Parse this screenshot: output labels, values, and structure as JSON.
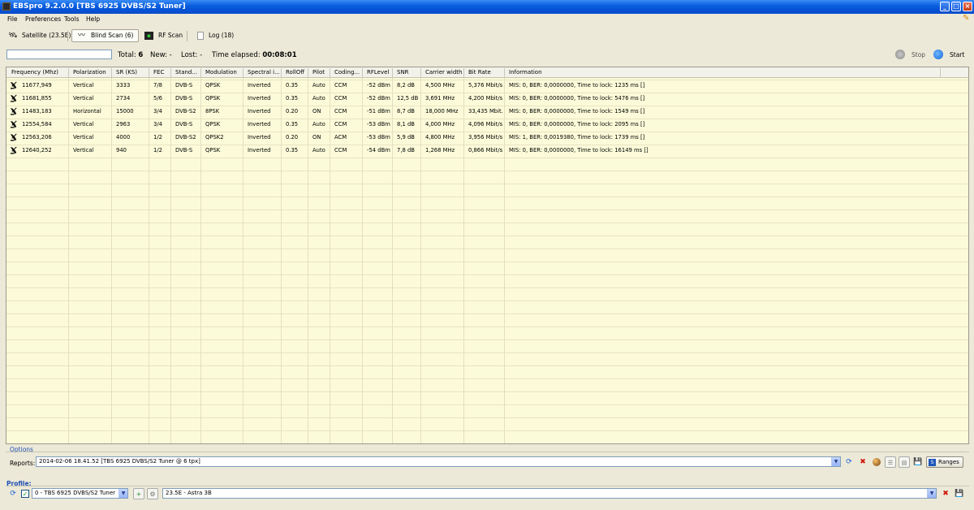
{
  "window": {
    "title": "EBSpro 9.2.0.0 [TBS 6925 DVBS/S2 Tuner]"
  },
  "menu": [
    "File",
    "Preferences",
    "Tools",
    "Help"
  ],
  "tabs": [
    {
      "label": "Satellite (23.5E)",
      "icon": "satellite-icon",
      "active": false
    },
    {
      "label": "Blind Scan (6)",
      "icon": "blind-scan-icon",
      "active": true
    },
    {
      "label": "RF Scan",
      "icon": "rf-scan-icon",
      "active": false
    },
    {
      "label": "Log (18)",
      "icon": "log-icon",
      "active": false
    }
  ],
  "status": {
    "total_label": "Total:",
    "total_value": "6",
    "new_label": "New:",
    "new_value": "-",
    "lost_label": "Lost:",
    "lost_value": "-",
    "elapsed_label": "Time elapsed:",
    "elapsed_value": "00:08:01"
  },
  "controls": {
    "stop_label": "Stop",
    "start_label": "Start"
  },
  "table": {
    "columns": [
      "Frequency (Mhz)",
      "Polarization",
      "SR (KS)",
      "FEC",
      "Stand...",
      "Modulation",
      "Spectral i...",
      "RollOff",
      "Pilot",
      "Coding...",
      "RFLevel",
      "SNR",
      "Carrier width",
      "Bit Rate",
      "Information"
    ],
    "rows": [
      [
        "11677,949",
        "Vertical",
        "3333",
        "7/8",
        "DVB-S",
        "QPSK",
        "Inverted",
        "0.35",
        "Auto",
        "CCM",
        "-52 dBm",
        "8,2 dB",
        "4,500 MHz",
        "5,376 Mbit/s",
        "MIS: 0, BER: 0,0000000, Time to lock: 1235 ms []"
      ],
      [
        "11681,855",
        "Vertical",
        "2734",
        "5/6",
        "DVB-S",
        "QPSK",
        "Inverted",
        "0.35",
        "Auto",
        "CCM",
        "-52 dBm",
        "12,5 dB",
        "3,691 MHz",
        "4,200 Mbit/s",
        "MIS: 0, BER: 0,0000000, Time to lock: 5476 ms []"
      ],
      [
        "11483,183",
        "Horizontal",
        "15000",
        "3/4",
        "DVB-S2",
        "8PSK",
        "Inverted",
        "0.20",
        "ON",
        "CCM",
        "-51 dBm",
        "8,7 dB",
        "18,000 MHz",
        "33,435 Mbit...",
        "MIS: 0, BER: 0,0000000, Time to lock: 1549 ms []"
      ],
      [
        "12554,584",
        "Vertical",
        "2963",
        "3/4",
        "DVB-S",
        "QPSK",
        "Inverted",
        "0.35",
        "Auto",
        "CCM",
        "-53 dBm",
        "8,1 dB",
        "4,000 MHz",
        "4,096 Mbit/s",
        "MIS: 0, BER: 0,0000000, Time to lock: 2095 ms []"
      ],
      [
        "12563,206",
        "Vertical",
        "4000",
        "1/2",
        "DVB-S2",
        "QPSK2",
        "Inverted",
        "0.20",
        "ON",
        "ACM",
        "-53 dBm",
        "5,9 dB",
        "4,800 MHz",
        "3,956 Mbit/s",
        "MIS: 1, BER: 0,0019380, Time to lock: 1739 ms []"
      ],
      [
        "12640,252",
        "Vertical",
        "940",
        "1/2",
        "DVB-S",
        "QPSK",
        "Inverted",
        "0.35",
        "Auto",
        "CCM",
        "-54 dBm",
        "7,8 dB",
        "1,268 MHz",
        "0,866 Mbit/s",
        "MIS: 0, BER: 0,0000000, Time to lock: 16149 ms []"
      ]
    ]
  },
  "options": {
    "section_label": "Options",
    "reports_label": "Reports:",
    "reports_value": "2014-02-06 18.41.52 [TBS 6925 DVBS/S2 Tuner @ 6 tpx]",
    "ranges_label": "Ranges"
  },
  "profile": {
    "section_label": "Profile:",
    "tuner_value": "0 - TBS 6925 DVBS/S2 Tuner",
    "satellite_value": "23.5E - Astra 3B"
  },
  "colors": {
    "grid_bg": "#fcfbd9",
    "accent": "#1f4fb4",
    "titlebar": "#0552d6"
  }
}
